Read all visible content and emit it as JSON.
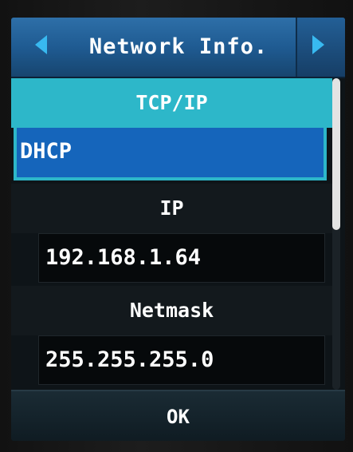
{
  "header": {
    "title": "Network Info.",
    "left_arrow_icon": "arrow-left-icon",
    "right_arrow_icon": "arrow-right-icon"
  },
  "tcp": {
    "label": "TCP/IP",
    "value": "DHCP"
  },
  "ip": {
    "label": "IP",
    "value": "192.168.1.64"
  },
  "netmask": {
    "label": "Netmask",
    "value": "255.255.255.0"
  },
  "ok": {
    "label": "OK"
  },
  "colors": {
    "title_bar": "#1f5b92",
    "arrow": "#38b9f0",
    "selected_header": "#2db7c9",
    "selected_value": "#1565bb"
  }
}
